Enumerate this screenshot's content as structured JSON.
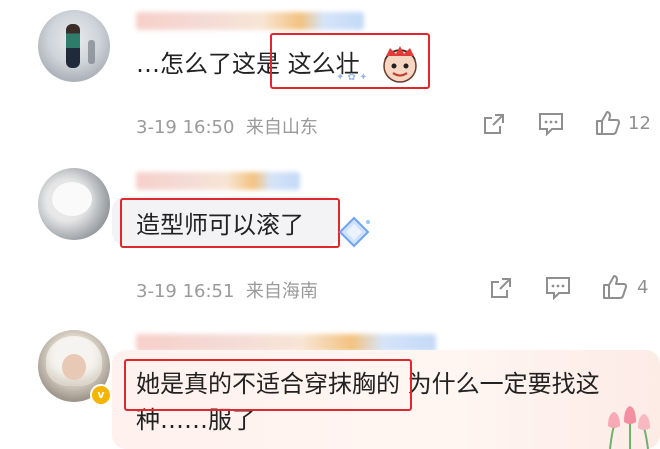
{
  "comments": [
    {
      "text": "…怎么了这是 这么壮",
      "text_plain": "…怎么了这是 ",
      "text_highlight": "这么壮",
      "date": "3-19 16:50",
      "location": "来自山东",
      "likes": "12"
    },
    {
      "text": "造型师可以滚了",
      "date": "3-19 16:51",
      "location": "来自海南",
      "likes": "4"
    },
    {
      "text_highlight": "她是真的不适合穿抹胸的",
      "text_rest": " 为什么一定要找这种……服了",
      "text_line1_rest": " 为什么一定要找这",
      "text_line2": "种……服了",
      "badge": "v"
    }
  ],
  "icons": {
    "share": "share-icon",
    "reply": "comment-icon",
    "like": "thumbs-up-icon"
  },
  "colors": {
    "highlight_border": "#e0272d",
    "meta_text": "#9a9a9a",
    "verified_badge": "#f5b400"
  }
}
